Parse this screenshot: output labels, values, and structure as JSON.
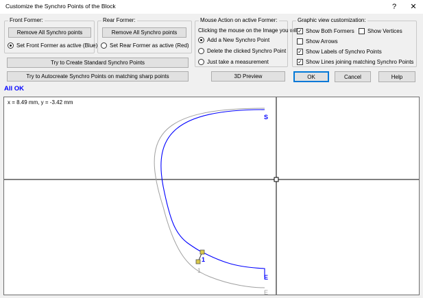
{
  "window": {
    "title": "Customize the Synchro Points of the Block",
    "help_glyph": "?",
    "close_glyph": "✕"
  },
  "front_former": {
    "label": "Front Former:",
    "remove_button": "Remove All Synchro points",
    "set_active_label": "Set Front Former as active (Blue)",
    "set_active_selected": true
  },
  "rear_former": {
    "label": "Rear Former:",
    "remove_button": "Remove All Synchro points",
    "set_active_label": "Set Rear Former as active (Red)",
    "set_active_selected": false
  },
  "mouse_action": {
    "label": "Mouse Action on active Former:",
    "description": "Clicking the mouse on the Image you will",
    "options": [
      {
        "label": "Add a New Synchro Point",
        "selected": true
      },
      {
        "label": "Delete the clicked Synchro Point",
        "selected": false
      },
      {
        "label": "Just take a measurement",
        "selected": false
      }
    ]
  },
  "graphic_view": {
    "label": "Graphic view customization:",
    "show_both_formers": {
      "label": "Show Both Formers",
      "checked": true
    },
    "show_vertices": {
      "label": "Show Vertices",
      "checked": false
    },
    "show_arrows": {
      "label": "Show Arrows",
      "checked": false
    },
    "show_labels": {
      "label": "Show Labels of Synchro Points",
      "checked": true
    },
    "show_lines": {
      "label": "Show Lines joining matching Synchro Points",
      "checked": true
    }
  },
  "buttons": {
    "create_standard": "Try to Create Standard Synchro Points",
    "autocreate": "Try to Autocreate Synchro Points on matching sharp points",
    "preview_3d": "3D Preview",
    "ok": "OK",
    "cancel": "Cancel",
    "help": "Help"
  },
  "status": {
    "text": "All OK",
    "color": "#0000ff"
  },
  "canvas": {
    "coordinate_readout": "x = 8.49 mm, y = -3.42 mm",
    "front_former_color": "#0000ff",
    "rear_former_color": "#a0a0a0",
    "front_labels": [
      "S",
      "1",
      "E"
    ],
    "rear_labels": [
      "1",
      "E"
    ]
  }
}
